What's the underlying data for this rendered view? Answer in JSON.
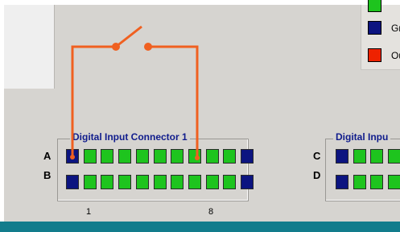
{
  "colors": {
    "input_on": "#1ec41e",
    "ground": "#0c1480",
    "output": "#ee2200",
    "wire": "#f06020"
  },
  "legend": [
    {
      "key": "input",
      "color": "#1ec41e",
      "label": ""
    },
    {
      "key": "ground",
      "color": "#0c1480",
      "label": "Gr"
    },
    {
      "key": "output",
      "color": "#ee2200",
      "label": "Ou"
    }
  ],
  "connector1": {
    "title": "Digital Input Connector 1",
    "rows": [
      {
        "label": "A",
        "pins": [
          "G",
          "I",
          "I",
          "I",
          "I",
          "I",
          "I",
          "I",
          "I",
          "I",
          "G"
        ]
      },
      {
        "label": "B",
        "pins": [
          "G",
          "I",
          "I",
          "I",
          "I",
          "I",
          "I",
          "I",
          "I",
          "I",
          "G"
        ]
      }
    ],
    "pin_numbers": [
      "1",
      "8"
    ]
  },
  "connector2": {
    "title": "Digital Inpu",
    "rows": [
      {
        "label": "C",
        "pins": [
          "G",
          "I",
          "I",
          "I",
          "I"
        ]
      },
      {
        "label": "D",
        "pins": [
          "G",
          "I",
          "I",
          "I",
          "I"
        ]
      }
    ]
  },
  "switch": {
    "state": "open"
  }
}
